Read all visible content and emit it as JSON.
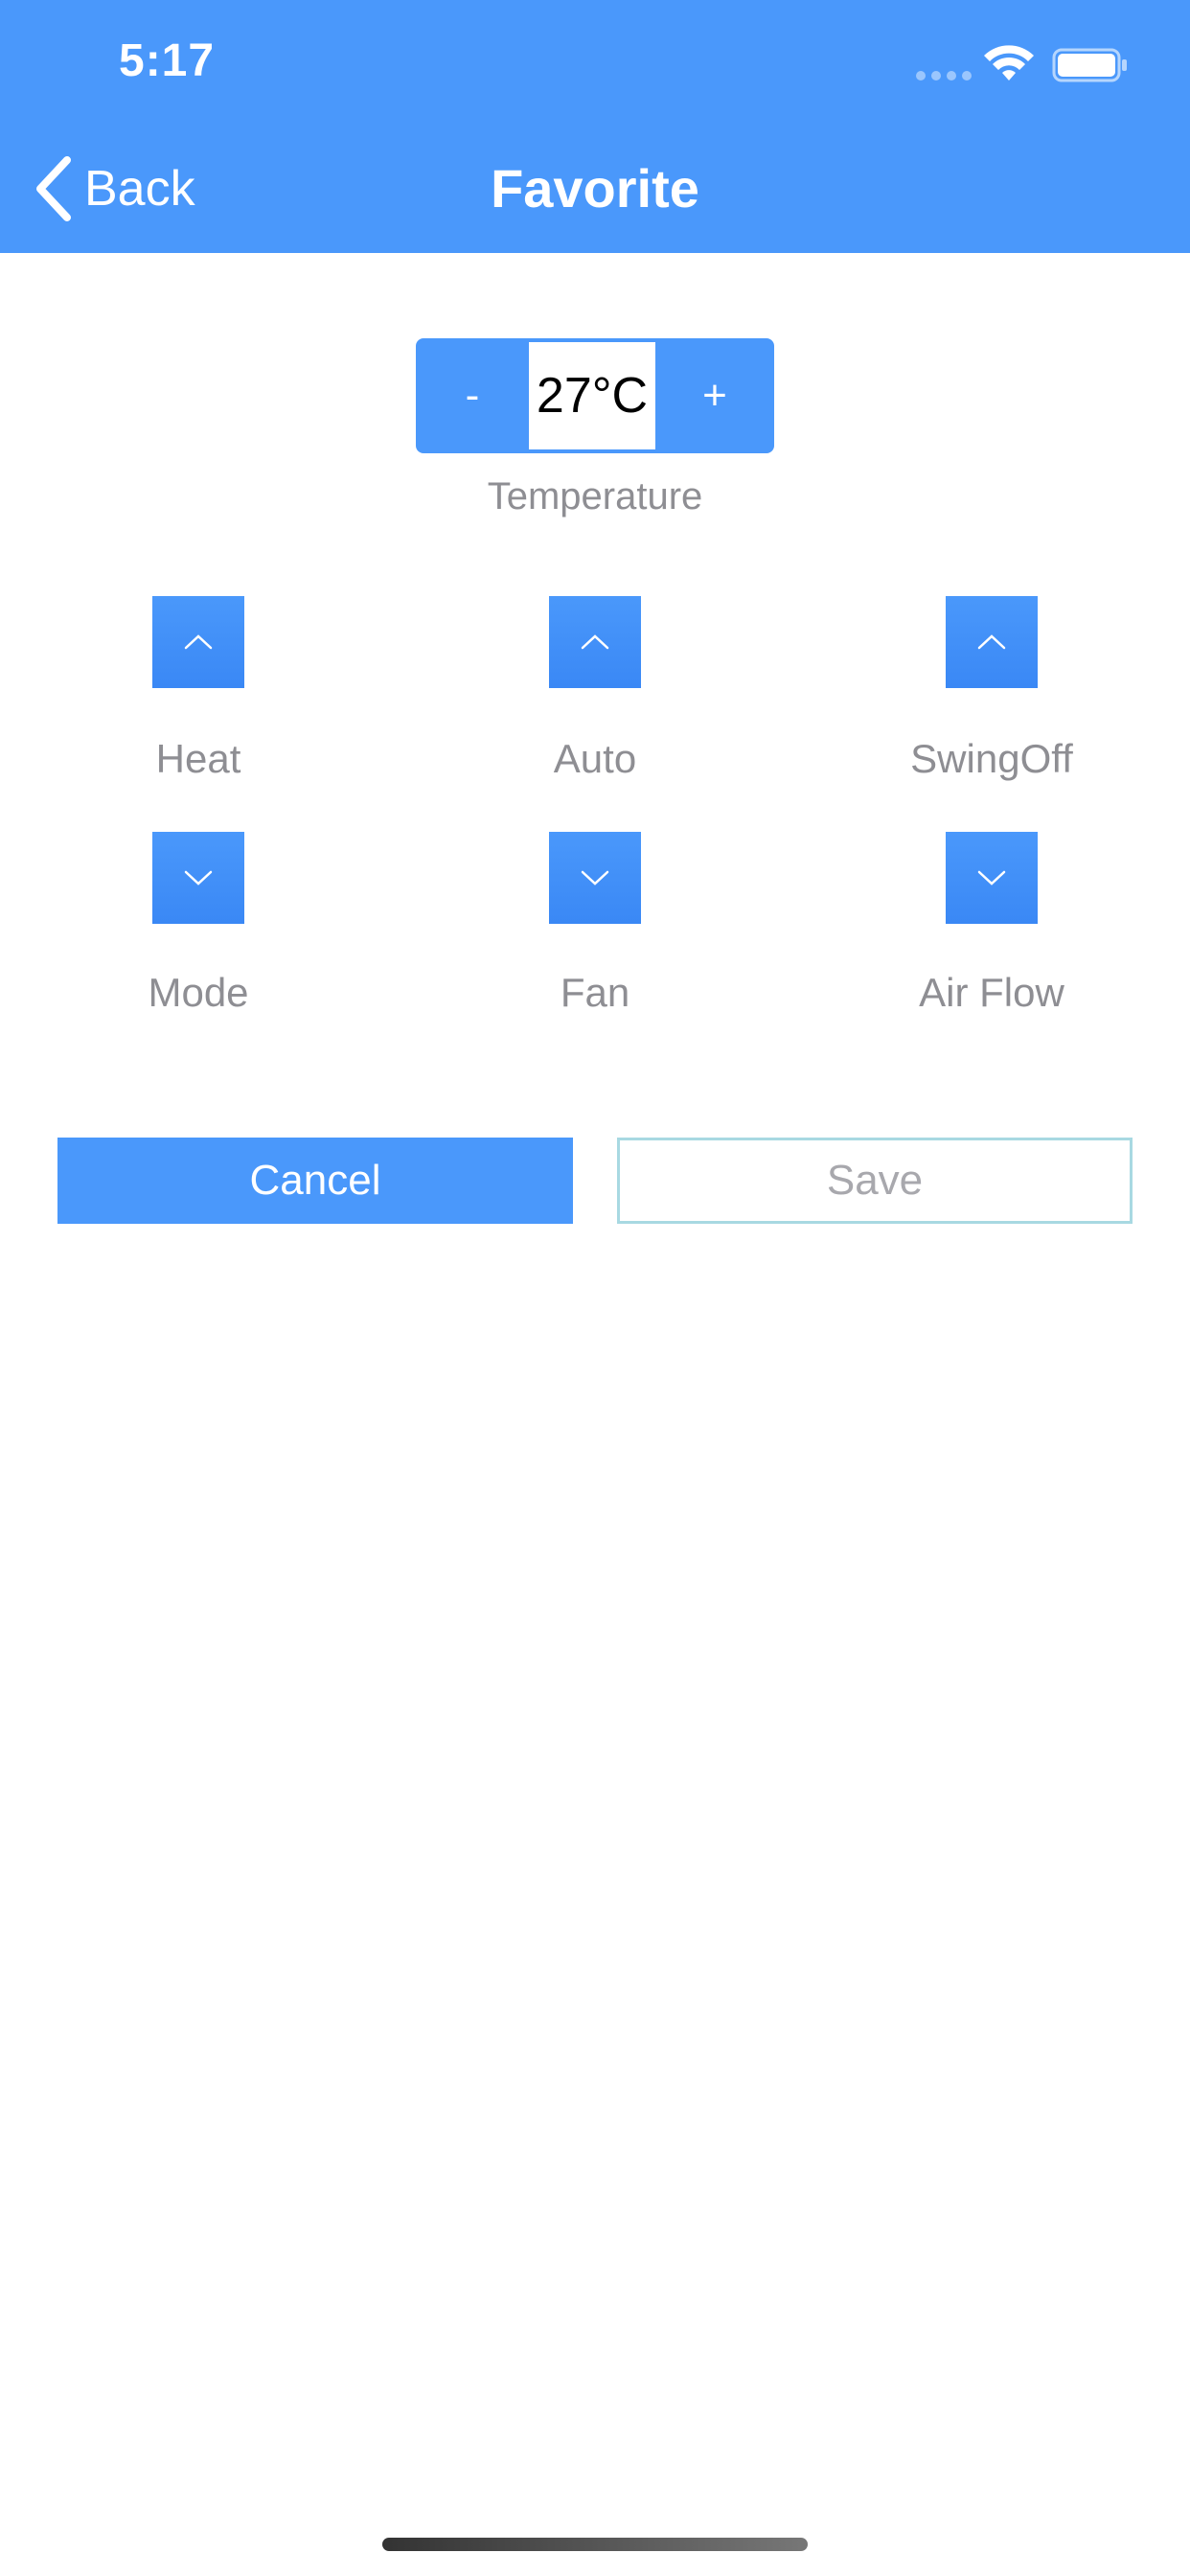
{
  "status_bar": {
    "time": "5:17",
    "signal_icon": "signal-dots-icon",
    "wifi_icon": "wifi-icon",
    "battery_icon": "battery-icon"
  },
  "nav": {
    "back_label": "Back",
    "back_icon": "chevron-left-icon",
    "title": "Favorite"
  },
  "temperature": {
    "minus_label": "-",
    "value": "27°C",
    "plus_label": "+",
    "label": "Temperature"
  },
  "controls": {
    "mode_current": "Heat",
    "fan_current": "Auto",
    "airflow_current": "SwingOff",
    "mode_label": "Mode",
    "fan_label": "Fan",
    "airflow_label": "Air Flow",
    "up_icon": "chevron-up-icon",
    "down_icon": "chevron-down-icon"
  },
  "actions": {
    "cancel_label": "Cancel",
    "save_label": "Save"
  },
  "colors": {
    "accent": "#4a98fb",
    "label_gray": "#8e8e93",
    "save_border": "#a8d9e2"
  }
}
